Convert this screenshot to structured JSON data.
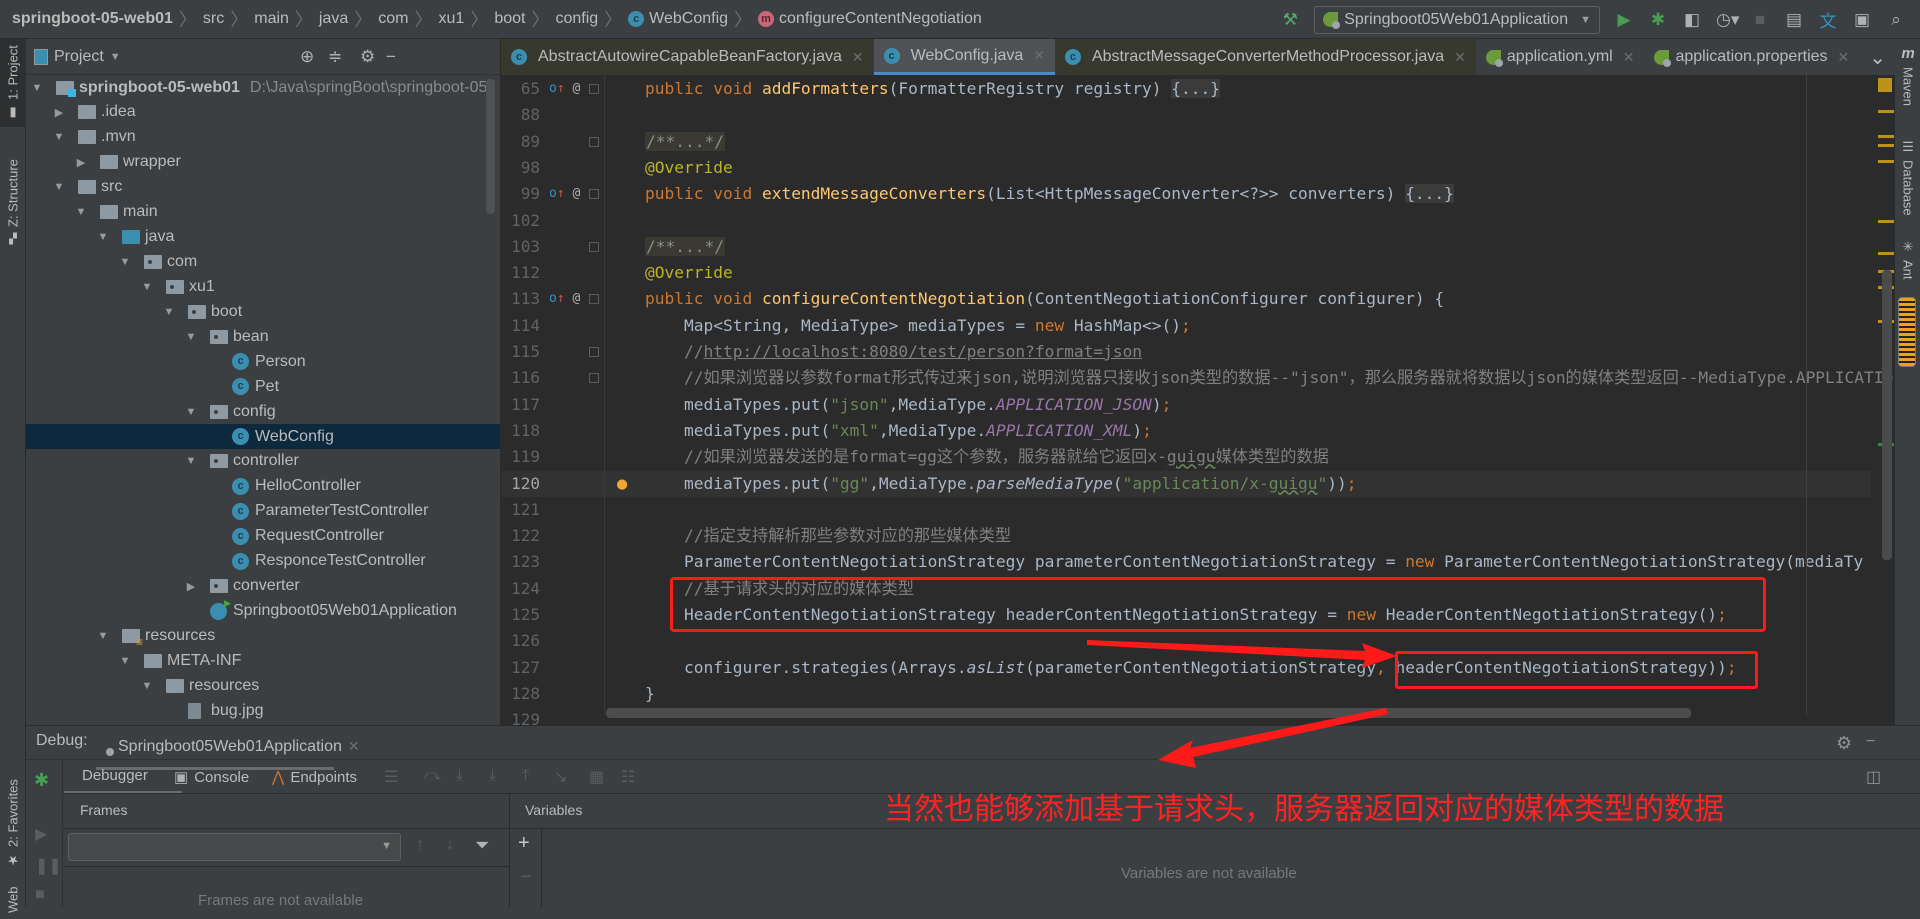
{
  "breadcrumb": [
    "springboot-05-web01",
    "src",
    "main",
    "java",
    "com",
    "xu1",
    "boot",
    "config",
    "WebConfig",
    "configureContentNegotiation"
  ],
  "run_config": "Springboot05Web01Application",
  "left_strip": {
    "project": "1: Project",
    "structure": "Z: Structure",
    "favorites": "2: Favorites",
    "web": "Web"
  },
  "right_strip": {
    "maven": "Maven",
    "database": "Database",
    "ant": "Ant"
  },
  "project": {
    "title": "Project",
    "items": [
      {
        "depth": 0,
        "arrow": "open",
        "icon": "module",
        "label": "springboot-05-web01",
        "path": "D:\\Java\\springBoot\\springboot-05-"
      },
      {
        "depth": 1,
        "arrow": "closed",
        "icon": "folder",
        "label": ".idea"
      },
      {
        "depth": 1,
        "arrow": "open",
        "icon": "folder",
        "label": ".mvn"
      },
      {
        "depth": 2,
        "arrow": "closed",
        "icon": "folder",
        "label": "wrapper"
      },
      {
        "depth": 1,
        "arrow": "open",
        "icon": "folder",
        "label": "src"
      },
      {
        "depth": 2,
        "arrow": "open",
        "icon": "folder",
        "label": "main"
      },
      {
        "depth": 3,
        "arrow": "open",
        "icon": "source-folder",
        "label": "java"
      },
      {
        "depth": 4,
        "arrow": "open",
        "icon": "package",
        "label": "com"
      },
      {
        "depth": 5,
        "arrow": "open",
        "icon": "package",
        "label": "xu1"
      },
      {
        "depth": 6,
        "arrow": "open",
        "icon": "package",
        "label": "boot"
      },
      {
        "depth": 7,
        "arrow": "open",
        "icon": "package",
        "label": "bean"
      },
      {
        "depth": 8,
        "arrow": null,
        "icon": "class",
        "label": "Person"
      },
      {
        "depth": 8,
        "arrow": null,
        "icon": "class",
        "label": "Pet"
      },
      {
        "depth": 7,
        "arrow": "open",
        "icon": "package",
        "label": "config"
      },
      {
        "depth": 8,
        "arrow": null,
        "icon": "class",
        "label": "WebConfig",
        "selected": true
      },
      {
        "depth": 7,
        "arrow": "open",
        "icon": "package",
        "label": "controller"
      },
      {
        "depth": 8,
        "arrow": null,
        "icon": "class",
        "label": "HelloController"
      },
      {
        "depth": 8,
        "arrow": null,
        "icon": "class",
        "label": "ParameterTestController"
      },
      {
        "depth": 8,
        "arrow": null,
        "icon": "class",
        "label": "RequestController"
      },
      {
        "depth": 8,
        "arrow": null,
        "icon": "class",
        "label": "ResponceTestController"
      },
      {
        "depth": 7,
        "arrow": "closed",
        "icon": "package",
        "label": "converter"
      },
      {
        "depth": 7,
        "arrow": null,
        "icon": "spring-app",
        "label": "Springboot05Web01Application"
      },
      {
        "depth": 3,
        "arrow": "open",
        "icon": "resources-folder",
        "label": "resources"
      },
      {
        "depth": 4,
        "arrow": "open",
        "icon": "folder",
        "label": "META-INF"
      },
      {
        "depth": 5,
        "arrow": "open",
        "icon": "folder",
        "label": "resources"
      },
      {
        "depth": 6,
        "arrow": null,
        "icon": "image-file",
        "label": "bug.jpg"
      }
    ]
  },
  "tabs": [
    {
      "label": "AbstractAutowireCapableBeanFactory.java",
      "icon": "class-readonly",
      "style": "dim"
    },
    {
      "label": "WebConfig.java",
      "icon": "class",
      "style": "active"
    },
    {
      "label": "AbstractMessageConverterMethodProcessor.java",
      "icon": "class-readonly",
      "style": "dim"
    },
    {
      "label": "application.yml",
      "icon": "spring-config",
      "style": ""
    },
    {
      "label": "application.properties",
      "icon": "spring-config",
      "style": ""
    }
  ],
  "editor": {
    "current_line": "120",
    "lines": [
      {
        "n": "65",
        "gutter": true,
        "fold": "+",
        "indent": 0,
        "t": [
          [
            "public void ",
            "kw"
          ],
          [
            "addFormatters",
            "fn"
          ],
          [
            "(FormatterRegistry registry) ",
            ""
          ],
          [
            "{...}",
            "fd"
          ]
        ]
      },
      {
        "n": "88",
        "t": []
      },
      {
        "n": "89",
        "fold": "+",
        "indent": 0,
        "t": [
          [
            "/**...*/",
            "doc"
          ]
        ]
      },
      {
        "n": "98",
        "indent": 0,
        "t": [
          [
            "@Override",
            "ann"
          ]
        ]
      },
      {
        "n": "99",
        "gutter": true,
        "fold": "+",
        "indent": 0,
        "t": [
          [
            "public void ",
            "kw"
          ],
          [
            "extendMessageConverters",
            "fn"
          ],
          [
            "(List<HttpMessageConverter<?>> converters) ",
            ""
          ],
          [
            "{...}",
            "fd"
          ]
        ]
      },
      {
        "n": "102",
        "t": []
      },
      {
        "n": "103",
        "fold": "+",
        "indent": 0,
        "t": [
          [
            "/**...*/",
            "doc"
          ]
        ]
      },
      {
        "n": "112",
        "indent": 0,
        "t": [
          [
            "@Override",
            "ann"
          ]
        ]
      },
      {
        "n": "113",
        "gutter": true,
        "fold": "-",
        "indent": 0,
        "t": [
          [
            "public void ",
            "kw"
          ],
          [
            "configureContentNegotiation",
            "fn"
          ],
          [
            "(ContentNegotiationConfigurer configurer) {",
            ""
          ]
        ]
      },
      {
        "n": "114",
        "indent": 4,
        "t": [
          [
            "Map<String, MediaType> mediaTypes = ",
            ""
          ],
          [
            "new ",
            "kw"
          ],
          [
            "HashMap<>()",
            ""
          ],
          [
            ";",
            "kw"
          ]
        ]
      },
      {
        "n": "115",
        "fold": "-",
        "indent": 4,
        "t": [
          [
            "//",
            "cm"
          ],
          [
            "http://localhost:8080/test/person?format=json",
            "link"
          ]
        ]
      },
      {
        "n": "116",
        "fold": "-",
        "indent": 4,
        "t": [
          [
            "//如果浏览器以参数format形式传过来json,说明浏览器只接收json类型的数据--\"json\"，那么服务器就将数据以json的媒体类型返回--MediaType.APPLICATIO",
            "cm"
          ]
        ]
      },
      {
        "n": "117",
        "indent": 4,
        "t": [
          [
            "mediaTypes.put(",
            ""
          ],
          [
            "\"json\"",
            "str"
          ],
          [
            ",MediaType.",
            ""
          ],
          [
            "APPLICATION_JSON",
            "cst"
          ],
          [
            ")",
            ""
          ],
          [
            ";",
            "kw"
          ]
        ]
      },
      {
        "n": "118",
        "indent": 4,
        "t": [
          [
            "mediaTypes.put(",
            ""
          ],
          [
            "\"xml\"",
            "str"
          ],
          [
            ",MediaType.",
            ""
          ],
          [
            "APPLICATION_XML",
            "cst"
          ],
          [
            ")",
            ""
          ],
          [
            ";",
            "kw"
          ]
        ]
      },
      {
        "n": "119",
        "indent": 4,
        "t": [
          [
            "//如果浏览器发送的是format=gg这个参数，服务器就给它返回x-",
            "cm"
          ],
          [
            "guigu",
            "cm wavy"
          ],
          [
            "媒体类型的数据",
            "cm"
          ]
        ]
      },
      {
        "n": "120",
        "bulb": true,
        "indent": 4,
        "t": [
          [
            "mediaTypes.put(",
            ""
          ],
          [
            "\"gg\"",
            "str"
          ],
          [
            ",MediaType.",
            ""
          ],
          [
            "parseMediaType",
            "it"
          ],
          [
            "(",
            ""
          ],
          [
            "\"application/x-",
            "str"
          ],
          [
            "guigu",
            "str wavy"
          ],
          [
            "\"",
            "str"
          ],
          [
            "))",
            ""
          ],
          [
            ";",
            "kw"
          ]
        ]
      },
      {
        "n": "121",
        "t": []
      },
      {
        "n": "122",
        "indent": 4,
        "t": [
          [
            "//指定支持解析那些参数对应的那些媒体类型",
            "cm"
          ]
        ]
      },
      {
        "n": "123",
        "indent": 4,
        "t": [
          [
            "ParameterContentNegotiationStrategy parameterContentNegotiationStrategy = ",
            ""
          ],
          [
            "new ",
            "kw"
          ],
          [
            "ParameterContentNegotiationStrategy(mediaTy",
            ""
          ]
        ]
      },
      {
        "n": "124",
        "indent": 4,
        "t": [
          [
            "//基于请求头的对应的媒体类型",
            "cm"
          ]
        ]
      },
      {
        "n": "125",
        "indent": 4,
        "t": [
          [
            "HeaderContentNegotiationStrategy headerContentNegotiationStrategy = ",
            ""
          ],
          [
            "new ",
            "kw"
          ],
          [
            "HeaderContentNegotiationStrategy()",
            ""
          ],
          [
            ";",
            "kw"
          ]
        ]
      },
      {
        "n": "126",
        "t": []
      },
      {
        "n": "127",
        "indent": 4,
        "t": [
          [
            "configurer.strategies(Arrays.",
            ""
          ],
          [
            "asList",
            "it"
          ],
          [
            "(parameterContentNegotiationStrategy",
            ""
          ],
          [
            ",",
            "kw"
          ],
          [
            " headerContentNegotiationStrategy))",
            ""
          ],
          [
            ";",
            "kw"
          ]
        ]
      },
      {
        "n": "128",
        "indent": 0,
        "t": [
          [
            "}",
            ""
          ]
        ]
      },
      {
        "n": "129",
        "t": []
      }
    ]
  },
  "debug": {
    "label": "Debug:",
    "session": "Springboot05Web01Application",
    "tabs": [
      "Debugger",
      "Console",
      "Endpoints"
    ],
    "frames_header": "Frames",
    "variables_header": "Variables",
    "frames_empty": "Frames are not available",
    "variables_empty": "Variables are not available"
  },
  "annotation": {
    "text": "当然也能够添加基于请求头，服务器返回对应的媒体类型的数据",
    "color": "#ff1a1a"
  },
  "colors": {
    "keyword": "#cc7832",
    "method": "#ffc66d",
    "comment": "#808080",
    "string": "#6a8759",
    "constant": "#9876aa",
    "annotation": "#bbb529",
    "selection": "#0d293e",
    "accent": "#4a88c7"
  }
}
